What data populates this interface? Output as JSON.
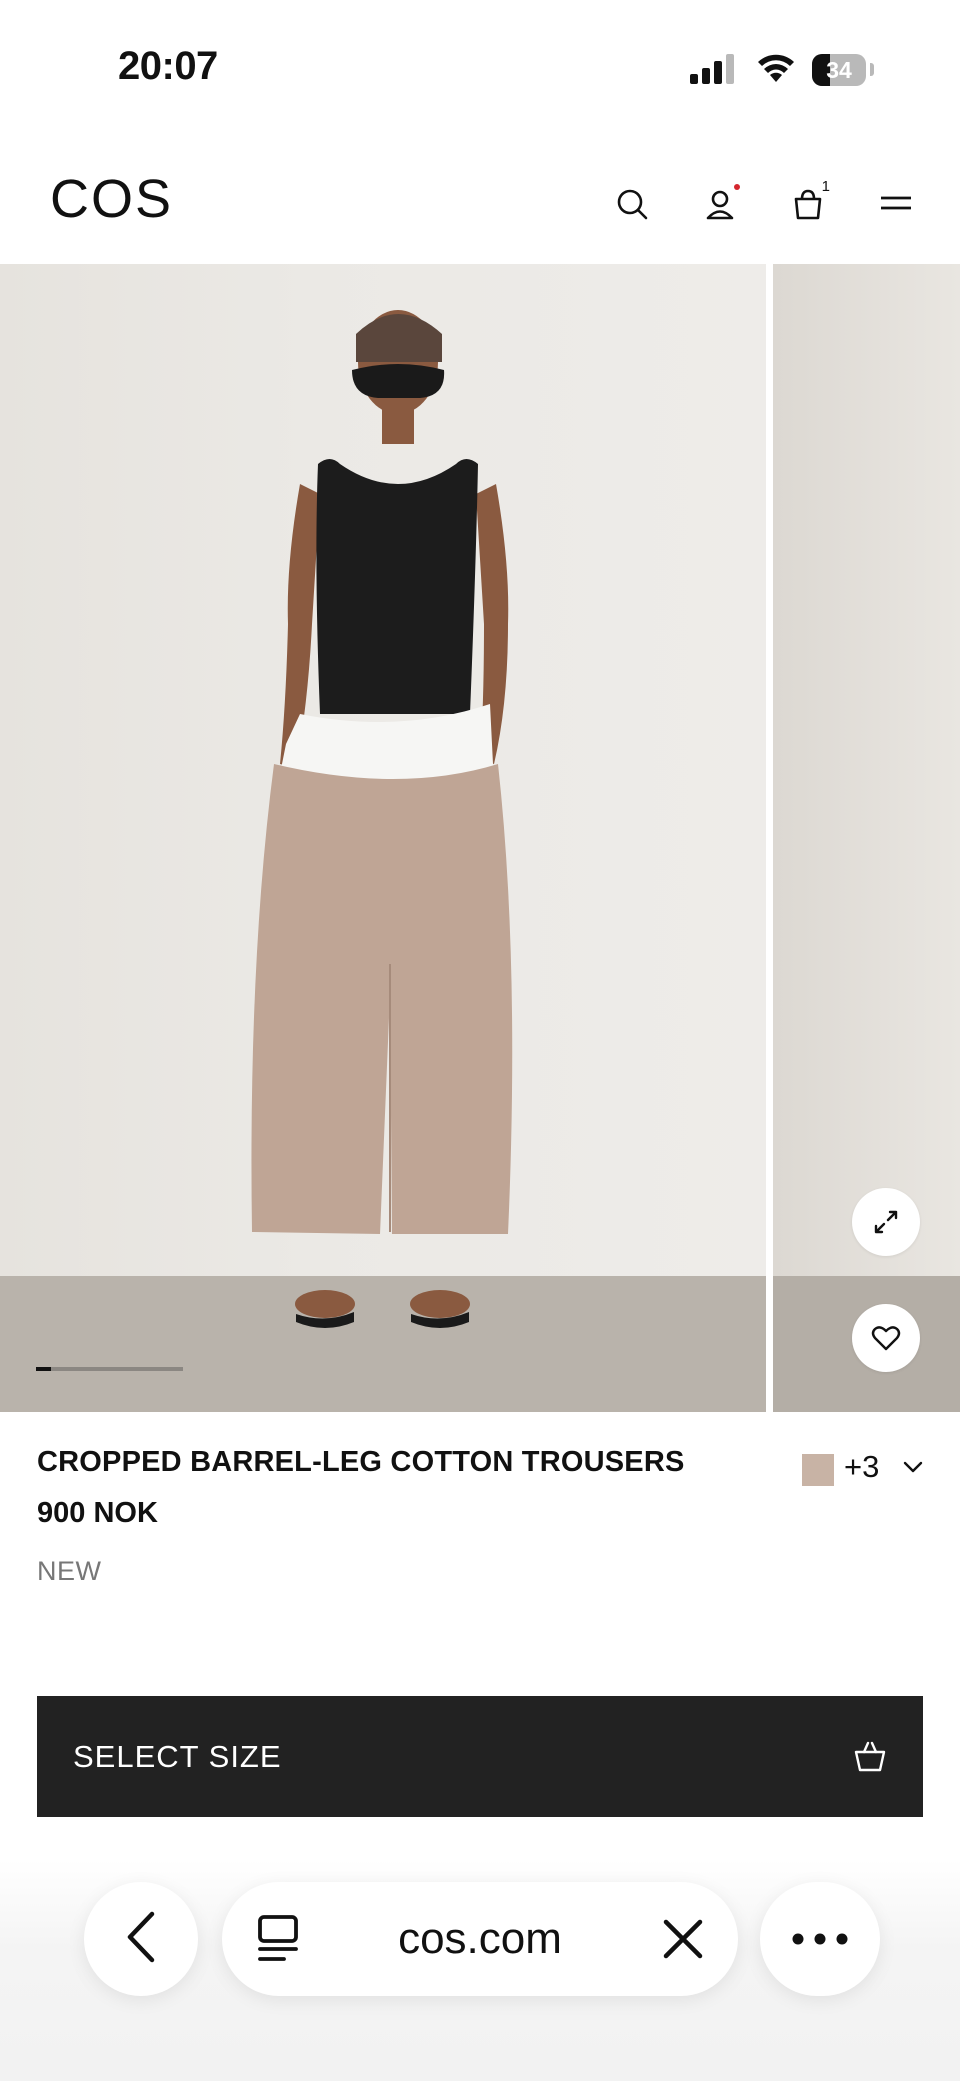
{
  "status_bar": {
    "time": "20:07",
    "battery_level": "34",
    "battery_fraction": 0.34,
    "signal_icon": "cellular-signal-icon",
    "wifi_icon": "wifi-icon"
  },
  "header": {
    "logo": "COS",
    "icons": [
      "search-icon",
      "account-icon",
      "shopping-bag-icon",
      "menu-icon"
    ],
    "bag_count": "1",
    "account_notification_color": "#d4262e"
  },
  "gallery": {
    "progress_fraction": 0.1,
    "expand_icon": "expand-icon",
    "wishlist_icon": "heart-icon"
  },
  "product": {
    "title": "CROPPED BARREL-LEG COTTON TROUSERS",
    "price": "900 NOK",
    "tag": "NEW",
    "swatch_color": "#c8b3a5",
    "more_colors": "+3"
  },
  "actions": {
    "select_size_label": "SELECT SIZE",
    "select_size_icon": "basket-icon",
    "button_color": "#222222"
  },
  "browser": {
    "url": "cos.com",
    "back_icon": "chevron-left-icon",
    "reader_icon": "tabs-icon",
    "close_icon": "close-icon",
    "more_icon": "more-icon"
  }
}
